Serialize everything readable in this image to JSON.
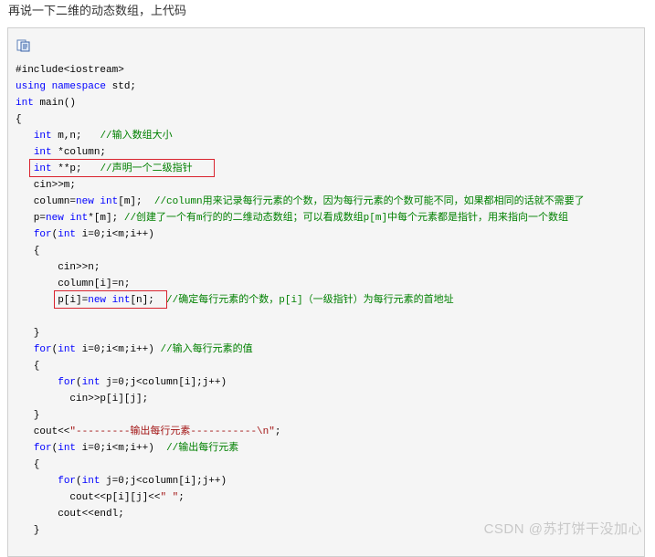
{
  "intro_text": "再说一下二维的动态数组，上代码",
  "icons": {
    "copy": "copy-code-icon"
  },
  "code_lines": [
    [
      {
        "t": "#include<iostream>",
        "c": ""
      }
    ],
    [
      {
        "t": "using namespace ",
        "c": "k"
      },
      {
        "t": "std;",
        "c": ""
      }
    ],
    [
      {
        "t": "int",
        "c": "k"
      },
      {
        "t": " main()",
        "c": ""
      }
    ],
    [
      {
        "t": "{",
        "c": ""
      }
    ],
    [
      {
        "t": "   ",
        "c": ""
      },
      {
        "t": "int",
        "c": "k"
      },
      {
        "t": " m,n;   ",
        "c": ""
      },
      {
        "t": "//输入数组大小",
        "c": "c"
      }
    ],
    [
      {
        "t": "   ",
        "c": ""
      },
      {
        "t": "int",
        "c": "k"
      },
      {
        "t": " *column;",
        "c": ""
      }
    ],
    [
      {
        "t": "   ",
        "c": ""
      },
      {
        "t": "int",
        "c": "k"
      },
      {
        "t": " **p;   ",
        "c": ""
      },
      {
        "t": "//声明一个二级指针",
        "c": "c"
      }
    ],
    [
      {
        "t": "   cin>>m;",
        "c": ""
      }
    ],
    [
      {
        "t": "   column=",
        "c": ""
      },
      {
        "t": "new int",
        "c": "k"
      },
      {
        "t": "[m];  ",
        "c": ""
      },
      {
        "t": "//column用来记录每行元素的个数，因为每行元素的个数可能不同，如果都相同的话就不需要了",
        "c": "c"
      }
    ],
    [
      {
        "t": "   p=",
        "c": ""
      },
      {
        "t": "new int",
        "c": "k"
      },
      {
        "t": "*[m]; ",
        "c": ""
      },
      {
        "t": "//创建了一个有m行的的二维动态数组；可以看成数组p[m]中每个元素都是指针，用来指向一个数组",
        "c": "c"
      }
    ],
    [
      {
        "t": "   ",
        "c": ""
      },
      {
        "t": "for",
        "c": "k"
      },
      {
        "t": "(",
        "c": ""
      },
      {
        "t": "int",
        "c": "k"
      },
      {
        "t": " i=0;i<m;i++)",
        "c": ""
      }
    ],
    [
      {
        "t": "   {",
        "c": ""
      }
    ],
    [
      {
        "t": "       cin>>n;",
        "c": ""
      }
    ],
    [
      {
        "t": "       column[i]=n;",
        "c": ""
      }
    ],
    [
      {
        "t": "       p[i]=",
        "c": ""
      },
      {
        "t": "new int",
        "c": "k"
      },
      {
        "t": "[n];  ",
        "c": ""
      },
      {
        "t": "//确定每行元素的个数，p[i]（一级指针）为每行元素的首地址",
        "c": "c"
      }
    ],
    [
      {
        "t": "",
        "c": ""
      }
    ],
    [
      {
        "t": "   }",
        "c": ""
      }
    ],
    [
      {
        "t": "   ",
        "c": ""
      },
      {
        "t": "for",
        "c": "k"
      },
      {
        "t": "(",
        "c": ""
      },
      {
        "t": "int",
        "c": "k"
      },
      {
        "t": " i=0;i<m;i++) ",
        "c": ""
      },
      {
        "t": "//输入每行元素的值",
        "c": "c"
      }
    ],
    [
      {
        "t": "   {",
        "c": ""
      }
    ],
    [
      {
        "t": "       ",
        "c": ""
      },
      {
        "t": "for",
        "c": "k"
      },
      {
        "t": "(",
        "c": ""
      },
      {
        "t": "int",
        "c": "k"
      },
      {
        "t": " j=0;j<column[i];j++)",
        "c": ""
      }
    ],
    [
      {
        "t": "         cin>>p[i][j];",
        "c": ""
      }
    ],
    [
      {
        "t": "   }",
        "c": ""
      }
    ],
    [
      {
        "t": "   cout<<",
        "c": ""
      },
      {
        "t": "\"---------输出每行元素-----------\\n\"",
        "c": "s"
      },
      {
        "t": ";",
        "c": ""
      }
    ],
    [
      {
        "t": "   ",
        "c": ""
      },
      {
        "t": "for",
        "c": "k"
      },
      {
        "t": "(",
        "c": ""
      },
      {
        "t": "int",
        "c": "k"
      },
      {
        "t": " i=0;i<m;i++)  ",
        "c": ""
      },
      {
        "t": "//输出每行元素",
        "c": "c"
      }
    ],
    [
      {
        "t": "   {",
        "c": ""
      }
    ],
    [
      {
        "t": "       ",
        "c": ""
      },
      {
        "t": "for",
        "c": "k"
      },
      {
        "t": "(",
        "c": ""
      },
      {
        "t": "int",
        "c": "k"
      },
      {
        "t": " j=0;j<column[i];j++)",
        "c": ""
      }
    ],
    [
      {
        "t": "         cout<<p[i][j]<<",
        "c": ""
      },
      {
        "t": "\" \"",
        "c": "s"
      },
      {
        "t": ";",
        "c": ""
      }
    ],
    [
      {
        "t": "       cout<<endl;",
        "c": ""
      }
    ],
    [
      {
        "t": "   }",
        "c": ""
      }
    ]
  ],
  "watermark": "CSDN @苏打饼干没加心"
}
